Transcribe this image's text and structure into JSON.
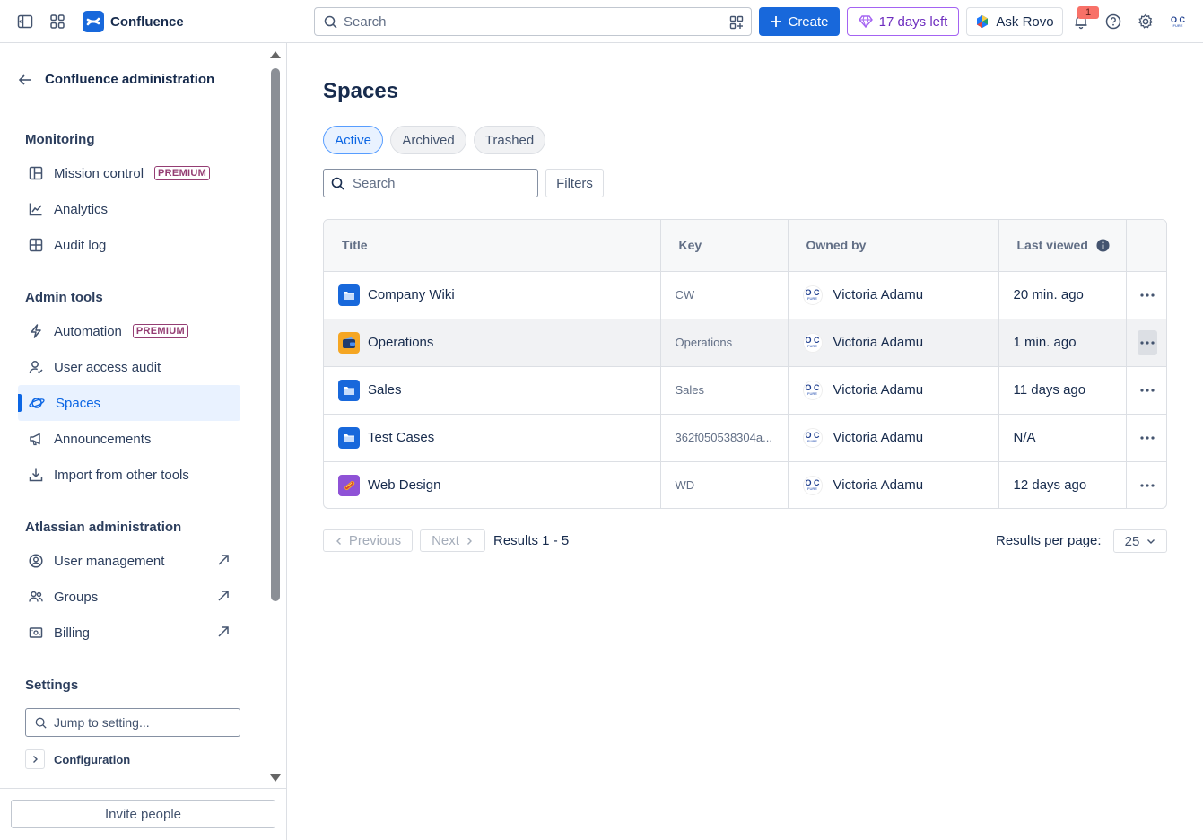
{
  "app": {
    "name": "Confluence"
  },
  "topbar": {
    "search_placeholder": "Search",
    "create_label": "Create",
    "trial_label": "17 days left",
    "rovo_label": "Ask Rovo",
    "notification_count": "1",
    "avatar_text": "O C",
    "avatar_sub": "FURE"
  },
  "sidebar": {
    "back_title": "Confluence administration",
    "sections": {
      "monitoring": "Monitoring",
      "admin_tools": "Admin tools",
      "atlassian_admin": "Atlassian administration",
      "settings": "Settings"
    },
    "items": {
      "mission_control": "Mission control",
      "analytics": "Analytics",
      "audit_log": "Audit log",
      "automation": "Automation",
      "user_access_audit": "User access audit",
      "spaces": "Spaces",
      "announcements": "Announcements",
      "import": "Import from other tools",
      "user_management": "User management",
      "groups": "Groups",
      "billing": "Billing"
    },
    "premium_badge": "PREMIUM",
    "jump_placeholder": "Jump to setting...",
    "configuration_label": "Configuration",
    "invite_label": "Invite people"
  },
  "main": {
    "title": "Spaces",
    "tabs": [
      "Active",
      "Archived",
      "Trashed"
    ],
    "search_placeholder": "Search",
    "filters_label": "Filters",
    "table": {
      "headers": [
        "Title",
        "Key",
        "Owned by",
        "Last viewed"
      ],
      "rows": [
        {
          "title": "Company Wiki",
          "key": "CW",
          "owner": "Victoria Adamu",
          "last_viewed": "20 min. ago",
          "icon": "folder-icon",
          "color": "#1868db"
        },
        {
          "title": "Operations",
          "key": "Operations",
          "owner": "Victoria Adamu",
          "last_viewed": "1 min. ago",
          "icon": "wallet-icon",
          "color": "#f5a623"
        },
        {
          "title": "Sales",
          "key": "Sales",
          "owner": "Victoria Adamu",
          "last_viewed": "11 days ago",
          "icon": "folder-icon",
          "color": "#1868db"
        },
        {
          "title": "Test Cases",
          "key": "362f050538304a...",
          "owner": "Victoria Adamu",
          "last_viewed": "N/A",
          "icon": "folder-icon",
          "color": "#1868db"
        },
        {
          "title": "Web Design",
          "key": "WD",
          "owner": "Victoria Adamu",
          "last_viewed": "12 days ago",
          "icon": "hotdog-icon",
          "color": "#8f52d6"
        }
      ]
    },
    "pagination": {
      "previous": "Previous",
      "next": "Next",
      "results": "Results 1 - 5",
      "per_page_label": "Results per page:",
      "per_page_value": "25"
    }
  }
}
